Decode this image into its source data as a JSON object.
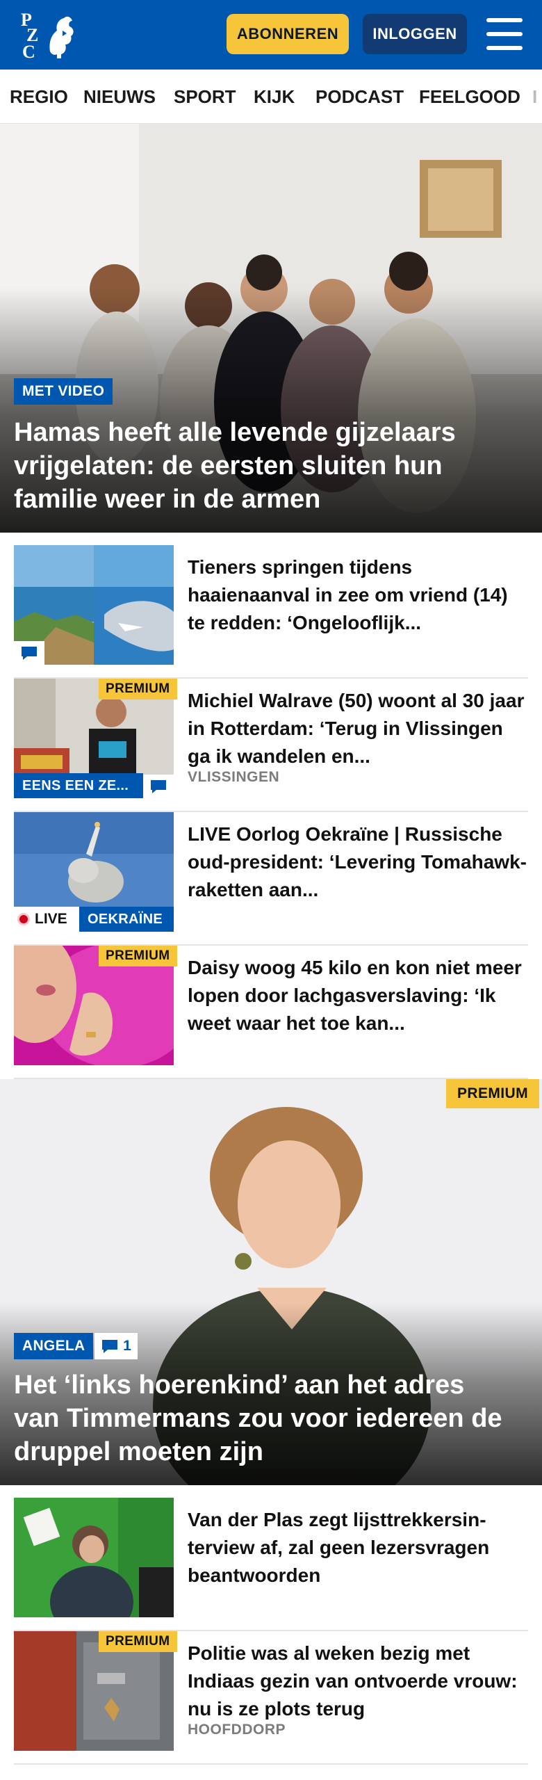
{
  "header": {
    "logo_letters": [
      "P",
      "Z",
      "C"
    ],
    "subscribe_label": "ABONNEREN",
    "login_label": "INLOGGEN",
    "menu_icon": "hamburger-menu-icon",
    "colors": {
      "brand": "#0057b0",
      "accent": "#f7c53a",
      "login_bg": "#123a73"
    }
  },
  "nav": {
    "items": [
      "REGIO",
      "NIEUWS",
      "SPORT",
      "KIJK",
      "PODCAST",
      "FEELGOOD",
      "I"
    ]
  },
  "hero": {
    "tag": "MET VIDEO",
    "title": "Hamas heeft alle levende gijzelaars vrijgelaten: de eersten sluiten hun familie weer in de armen"
  },
  "articles": [
    {
      "title": "Tieners springen tijdens haaienaanval in zee om vriend (14) te redden: ‘Ongelooflijk...",
      "icon": "comment-icon"
    },
    {
      "title": "Michiel Walrave (50) woont al 30 jaar in Rotterdam: ‘Terug in Vlissingen ga ik wandelen en...",
      "premium": "PREMIUM",
      "tag": "EENS EEN ZE...",
      "location": "VLISSINGEN",
      "icon": "comment-icon"
    },
    {
      "title": "LIVE Oorlog Oekraïne | Russische oud-president: ‘Levering Tomahawk-raketten aan...",
      "live_label": "LIVE",
      "tag": "OEKRAÏNE"
    },
    {
      "title": "Daisy woog 45 kilo en kon niet meer lopen door lachgasversla­ving: ‘Ik weet waar het toe kan...",
      "premium": "PREMIUM"
    }
  ],
  "feature": {
    "premium": "PREMIUM",
    "tag": "ANGELA",
    "comment_count": "1",
    "title": "Het ‘links hoerenkind’ aan het adres van Timmermans zou voor iedereen de druppel moeten zijn"
  },
  "articles2": [
    {
      "title": "Van der Plas zegt lijsttrekkersin­terview af, zal geen lezersvragen beantwoorden"
    },
    {
      "title": "Politie was al weken bezig met Indiaas gezin van ontvoerde vrouw: nu is ze plots terug",
      "premium": "PREMIUM",
      "location": "HOOFDDORP"
    }
  ]
}
